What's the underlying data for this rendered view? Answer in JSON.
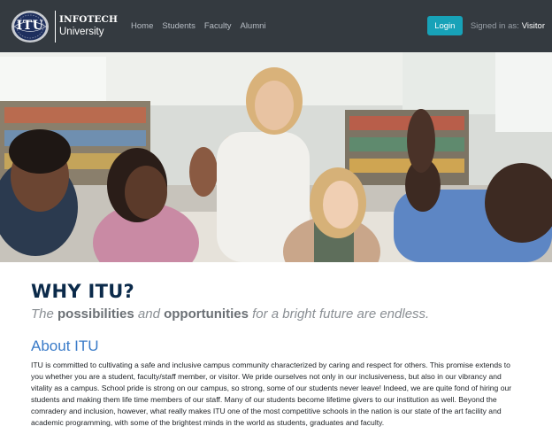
{
  "navbar": {
    "logo_text": "ITU",
    "brand_top": "INFOTECH",
    "brand_bottom": "University",
    "links": [
      "Home",
      "Students",
      "Faculty",
      "Alumni"
    ],
    "login_label": "Login",
    "signed_in_label": "Signed in as:",
    "signed_in_user": "Visitor",
    "login_color": "#17a2b8",
    "bg_color": "#343a40"
  },
  "hero": {
    "icon": "group-photo-students-high-five"
  },
  "main": {
    "title": "WHY ITU?",
    "tagline": {
      "p1": "The ",
      "b1": "possibilities",
      "p2": " and ",
      "b2": "opportunities",
      "p3": " for a bright future are endless."
    },
    "about_title": "About ITU",
    "about_body": "ITU is committed to cultivating a safe and inclusive campus community characterized by caring and respect for others. This promise extends to you whether you are a student, faculty/staff member, or visitor. We pride ourselves not only in our inclusiveness, but also in our vibrancy and vitality as a campus. School pride is strong on our campus, so strong, some of our students never leave! Indeed, we are quite fond of hiring our students and making them life time members of our staff. Many of our students become lifetime givers to our institution as well. Beyond the comradery and inclusion, however, what really makes ITU one of the most competitive schools in the nation is our state of the art facility and academic programming, with some of the brightest minds in the world as students, graduates and faculty."
  }
}
